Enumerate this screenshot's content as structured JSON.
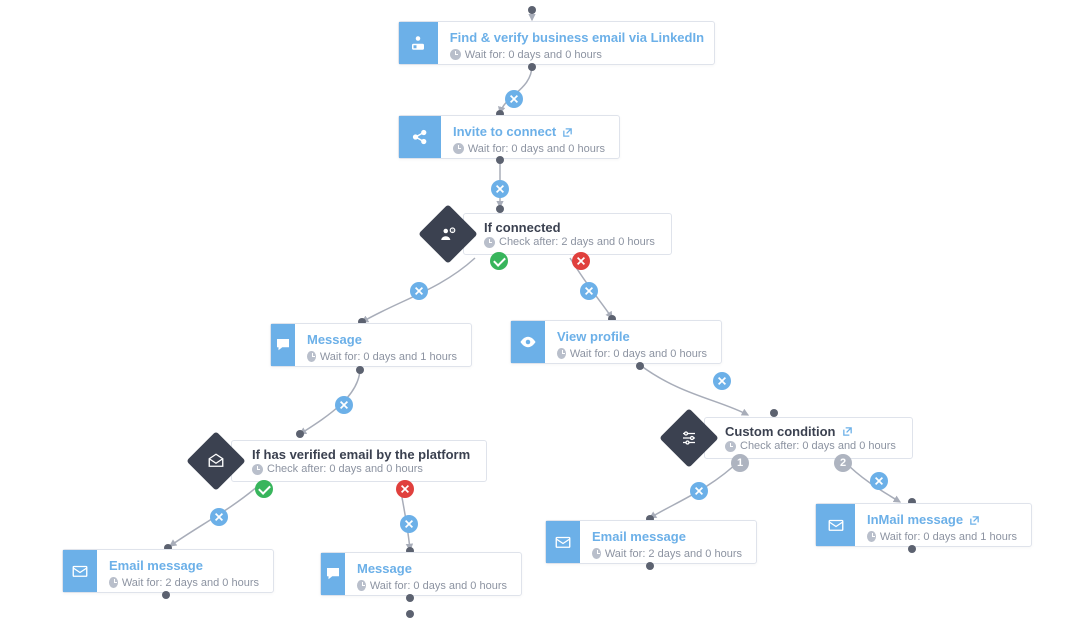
{
  "nodes": {
    "findEmail": {
      "title": "Find & verify business email via LinkedIn",
      "wait": "Wait for: 0 days and 0 hours",
      "ext": true
    },
    "invite": {
      "title": "Invite to connect",
      "wait": "Wait for: 0 days and 0 hours",
      "ext": true
    },
    "ifConnected": {
      "title": "If connected",
      "wait": "Check after: 2 days and 0 hours"
    },
    "msgYes": {
      "title": "Message",
      "wait": "Wait for: 0 days and 1 hours"
    },
    "viewProfile": {
      "title": "View profile",
      "wait": "Wait for: 0 days and 0 hours"
    },
    "ifVerified": {
      "title": "If has verified email by the platform",
      "wait": "Check after: 0 days and 0 hours"
    },
    "emailYes": {
      "title": "Email message",
      "wait": "Wait for: 2 days and 0 hours"
    },
    "msgNo": {
      "title": "Message",
      "wait": "Wait for: 0 days and 0 hours"
    },
    "custom": {
      "title": "Custom condition",
      "wait": "Check after: 0 days and 0 hours",
      "ext": true
    },
    "email2": {
      "title": "Email message",
      "wait": "Wait for: 2 days and 0 hours"
    },
    "inmail": {
      "title": "InMail message",
      "wait": "Wait for: 0 days and 1 hours",
      "ext": true
    }
  },
  "branchNums": {
    "one": "1",
    "two": "2"
  },
  "colors": {
    "accent": "#6cb0e8",
    "dark": "#3b4150",
    "yes": "#38b55c",
    "no": "#e0403d",
    "grey": "#aeb4c0",
    "edge": "#a8adb9"
  }
}
